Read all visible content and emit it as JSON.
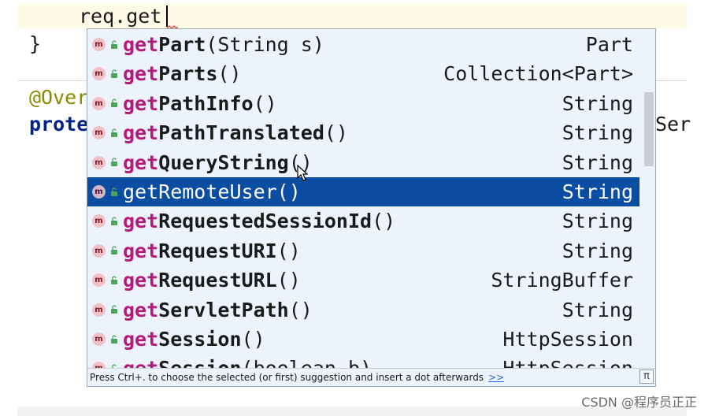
{
  "editor": {
    "line_current": "req.get",
    "line_brace": "}",
    "annotation_partial": "@Over",
    "keyword_partial": "prote",
    "right_partial": "Ser"
  },
  "popup": {
    "items": [
      {
        "prefix": "get",
        "rest": "Part",
        "params": "(String s)",
        "type": "Part"
      },
      {
        "prefix": "get",
        "rest": "Parts",
        "params": "()",
        "type": "Collection<Part>"
      },
      {
        "prefix": "get",
        "rest": "PathInfo",
        "params": "()",
        "type": "String"
      },
      {
        "prefix": "get",
        "rest": "PathTranslated",
        "params": "()",
        "type": "String"
      },
      {
        "prefix": "get",
        "rest": "QueryString",
        "params": "()",
        "type": "String"
      },
      {
        "prefix": "get",
        "rest": "RemoteUser",
        "params": "()",
        "type": "String",
        "selected": true
      },
      {
        "prefix": "get",
        "rest": "RequestedSessionId",
        "params": "()",
        "type": "String"
      },
      {
        "prefix": "get",
        "rest": "RequestURI",
        "params": "()",
        "type": "String"
      },
      {
        "prefix": "get",
        "rest": "RequestURL",
        "params": "()",
        "type": "StringBuffer"
      },
      {
        "prefix": "get",
        "rest": "ServletPath",
        "params": "()",
        "type": "String"
      },
      {
        "prefix": "get",
        "rest": "Session",
        "params": "()",
        "type": "HttpSession"
      },
      {
        "prefix": "get",
        "rest": "Session",
        "params": "(boolean b)",
        "type": "HttpSession"
      }
    ],
    "badge_letter": "m",
    "footer_hint": "Press Ctrl+. to choose the selected (or first) suggestion and insert a dot afterwards",
    "footer_link": ">>",
    "pi_label": "π"
  },
  "watermark": "CSDN @程序员正正",
  "colors": {
    "match_highlight": "#b3197a",
    "selection": "#0a4da1",
    "popup_bg": "#ecf3fc"
  }
}
